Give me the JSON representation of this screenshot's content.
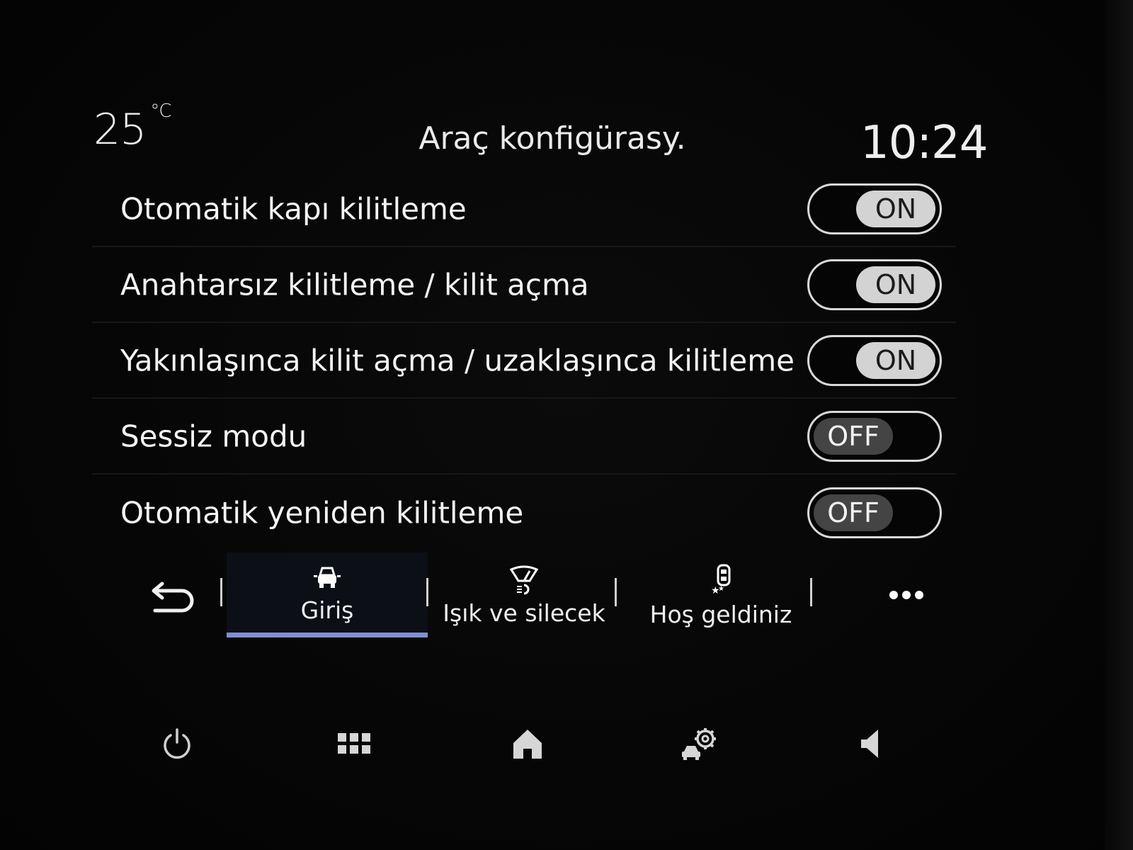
{
  "status": {
    "temperature": "25",
    "temperature_unit": "°C",
    "title": "Araç konfigürasy.",
    "clock": "10:24"
  },
  "settings": [
    {
      "label": "Otomatik kapı kilitleme",
      "state": "ON"
    },
    {
      "label": "Anahtarsız kilitleme / kilit açma",
      "state": "ON"
    },
    {
      "label": "Yakınlaşınca kilit açma / uzaklaşınca kilitleme",
      "state": "ON"
    },
    {
      "label": "Sessiz modu",
      "state": "OFF"
    },
    {
      "label": "Otomatik yeniden kilitleme",
      "state": "OFF"
    }
  ],
  "tabs": [
    {
      "label": "Giriş",
      "icon": "car-lock-icon",
      "active": true
    },
    {
      "label": "Işık ve silecek",
      "icon": "wiper-light-icon",
      "active": false
    },
    {
      "label": "Hoş geldiniz",
      "icon": "welcome-icon",
      "active": false
    }
  ],
  "nav": {
    "back_icon": "back-arrow-icon",
    "more_icon": "more-dots-icon",
    "power_icon": "power-icon",
    "apps_icon": "apps-grid-icon",
    "home_icon": "home-icon",
    "car_settings_icon": "car-settings-icon",
    "volume_icon": "speaker-icon"
  },
  "colors": {
    "active_tab_underline": "#7f8fd0",
    "toggle_on_knob": "#d3d3d3",
    "toggle_off_knob": "#444444"
  }
}
